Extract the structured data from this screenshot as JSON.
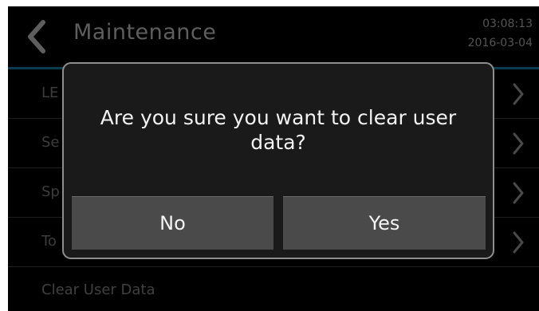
{
  "header": {
    "title": "Maintenance",
    "time": "03:08:13",
    "date": "2016-03-04",
    "back_icon": "chevron-left-icon"
  },
  "list": {
    "items": [
      {
        "label": "LE"
      },
      {
        "label": "Se"
      },
      {
        "label": "Sp"
      },
      {
        "label": "To"
      },
      {
        "label": "Clear User Data"
      }
    ],
    "chevron_icon": "chevron-right-icon"
  },
  "dialog": {
    "message": "Are you sure you want to clear user data?",
    "no_label": "No",
    "yes_label": "Yes"
  },
  "colors": {
    "background": "#000000",
    "dialog_background": "#1a1a1a",
    "dialog_border": "#8e8e8e",
    "button_background": "#4a4a4a",
    "header_rule": "#0a3c4d"
  }
}
